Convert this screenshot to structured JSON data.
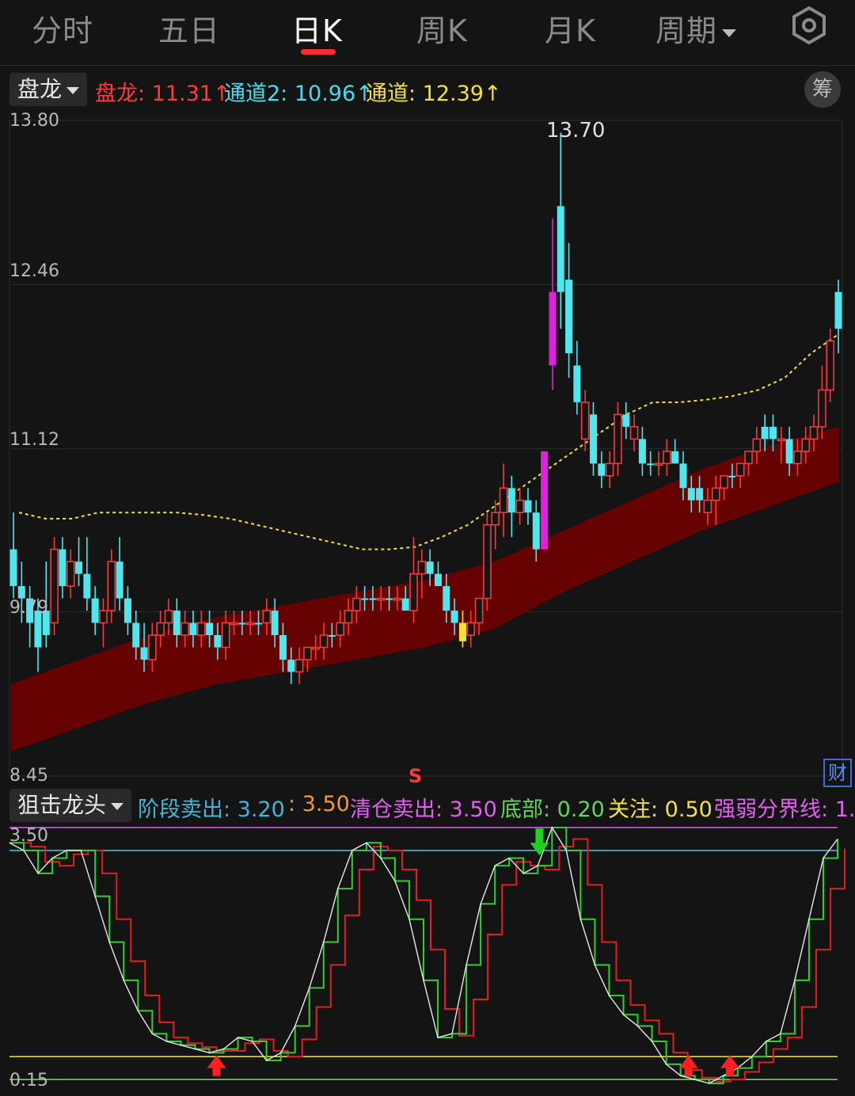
{
  "tabs": [
    {
      "label": "分时",
      "active": false
    },
    {
      "label": "五日",
      "active": false
    },
    {
      "label": "日K",
      "active": true
    },
    {
      "label": "周K",
      "active": false
    },
    {
      "label": "月K",
      "active": false
    },
    {
      "label": "周期",
      "active": false,
      "dropdown": true
    }
  ],
  "settings_icon": "settings-gear-icon",
  "main_indicator": {
    "selector_label": "盘龙",
    "values": [
      {
        "text": "盘龙: 11.31↑",
        "color": "#ff3b3b"
      },
      {
        "text": "通道2: 10.96↑",
        "color": "#3fe0f0"
      },
      {
        "text": "通道: 12.39↑",
        "color": "#f5e13a"
      }
    ],
    "chips_label": "筹"
  },
  "price_axis": {
    "labels": [
      "13.80",
      "12.46",
      "11.12",
      "9.79",
      "8.45"
    ]
  },
  "peak_label": "13.70",
  "signal_marker": "S",
  "cai_label": "财",
  "sub_indicator": {
    "selector_label": "狙击龙头",
    "values": [
      {
        "text": "阶段卖出: 3.20",
        "color": "#3fb8d8"
      },
      {
        "text": ": 3.50",
        "color": "#f09a30"
      },
      {
        "text": "清仓卖出: 3.50",
        "color": "#e060f0"
      },
      {
        "text": "底部: 0.20",
        "color": "#5ed85e"
      },
      {
        "text": "关注: 0.50",
        "color": "#f5e13a"
      },
      {
        "text": "强弱分界线: 1.",
        "color": "#e060f0"
      }
    ],
    "axis_labels": [
      "3.50",
      "0.15"
    ]
  },
  "colors": {
    "up": "#f23b3b",
    "down": "#4fe6ee",
    "band": "#6e0000",
    "ma": "#f5e13a"
  },
  "chart_data": {
    "type": "candlestick",
    "ylim": [
      8.45,
      13.8
    ],
    "peak_high": 13.7,
    "candles": [
      [
        10.3,
        10.6,
        9.9,
        10.0,
        "d"
      ],
      [
        10.0,
        10.2,
        9.7,
        9.9,
        "d"
      ],
      [
        9.9,
        10.0,
        9.5,
        9.7,
        "d"
      ],
      [
        9.5,
        9.9,
        9.3,
        9.8,
        "d"
      ],
      [
        9.8,
        10.2,
        9.5,
        9.6,
        "d"
      ],
      [
        9.7,
        10.4,
        9.6,
        10.3,
        "u"
      ],
      [
        10.3,
        10.4,
        9.9,
        10.0,
        "d"
      ],
      [
        10.0,
        10.3,
        9.9,
        10.2,
        "u"
      ],
      [
        10.2,
        10.4,
        10.0,
        10.1,
        "d"
      ],
      [
        10.1,
        10.4,
        9.8,
        9.9,
        "d"
      ],
      [
        9.9,
        10.0,
        9.6,
        9.7,
        "d"
      ],
      [
        9.7,
        9.9,
        9.5,
        9.8,
        "u"
      ],
      [
        9.8,
        10.3,
        9.7,
        10.2,
        "u"
      ],
      [
        10.2,
        10.4,
        9.8,
        9.9,
        "d"
      ],
      [
        9.9,
        10.0,
        9.6,
        9.7,
        "d"
      ],
      [
        9.7,
        9.8,
        9.4,
        9.5,
        "d"
      ],
      [
        9.5,
        9.7,
        9.3,
        9.4,
        "d"
      ],
      [
        9.4,
        9.7,
        9.3,
        9.6,
        "u"
      ],
      [
        9.6,
        9.8,
        9.5,
        9.7,
        "u"
      ],
      [
        9.7,
        9.9,
        9.6,
        9.8,
        "u"
      ],
      [
        9.8,
        9.9,
        9.5,
        9.6,
        "d"
      ],
      [
        9.6,
        9.8,
        9.5,
        9.7,
        "u"
      ],
      [
        9.7,
        9.8,
        9.5,
        9.6,
        "d"
      ],
      [
        9.6,
        9.8,
        9.5,
        9.7,
        "u"
      ],
      [
        9.7,
        9.8,
        9.5,
        9.6,
        "d"
      ],
      [
        9.6,
        9.7,
        9.4,
        9.5,
        "d"
      ],
      [
        9.5,
        9.8,
        9.4,
        9.7,
        "u"
      ],
      [
        9.7,
        9.8,
        9.6,
        9.7,
        "u"
      ],
      [
        9.7,
        9.8,
        9.6,
        9.7,
        "d"
      ],
      [
        9.7,
        9.8,
        9.6,
        9.7,
        "u"
      ],
      [
        9.7,
        9.8,
        9.6,
        9.7,
        "d"
      ],
      [
        9.7,
        9.9,
        9.6,
        9.8,
        "u"
      ],
      [
        9.8,
        9.9,
        9.5,
        9.6,
        "d"
      ],
      [
        9.6,
        9.7,
        9.3,
        9.4,
        "d"
      ],
      [
        9.4,
        9.5,
        9.2,
        9.3,
        "d"
      ],
      [
        9.3,
        9.5,
        9.2,
        9.4,
        "u"
      ],
      [
        9.4,
        9.5,
        9.3,
        9.5,
        "u"
      ],
      [
        9.5,
        9.6,
        9.4,
        9.5,
        "u"
      ],
      [
        9.5,
        9.7,
        9.4,
        9.6,
        "u"
      ],
      [
        9.6,
        9.7,
        9.5,
        9.6,
        "d"
      ],
      [
        9.6,
        9.8,
        9.5,
        9.7,
        "u"
      ],
      [
        9.7,
        9.9,
        9.6,
        9.8,
        "u"
      ],
      [
        9.8,
        10.0,
        9.7,
        9.9,
        "u"
      ],
      [
        9.9,
        10.0,
        9.8,
        9.9,
        "d"
      ],
      [
        9.9,
        10.0,
        9.8,
        9.9,
        "d"
      ],
      [
        9.9,
        10.0,
        9.8,
        9.9,
        "u"
      ],
      [
        9.9,
        10.0,
        9.8,
        9.9,
        "d"
      ],
      [
        9.9,
        10.0,
        9.8,
        9.9,
        "u"
      ],
      [
        9.9,
        10.0,
        9.8,
        9.8,
        "d"
      ],
      [
        9.8,
        10.4,
        9.7,
        10.1,
        "u"
      ],
      [
        10.1,
        10.3,
        9.9,
        10.2,
        "u"
      ],
      [
        10.2,
        10.3,
        10.0,
        10.1,
        "d"
      ],
      [
        10.1,
        10.2,
        10.0,
        10.0,
        "d"
      ],
      [
        10.0,
        10.1,
        9.7,
        9.8,
        "d"
      ],
      [
        9.8,
        9.9,
        9.6,
        9.7,
        "d"
      ],
      [
        9.7,
        9.8,
        9.5,
        9.55,
        "y"
      ],
      [
        9.6,
        9.8,
        9.5,
        9.7,
        "u"
      ],
      [
        9.7,
        9.9,
        9.6,
        9.9,
        "u"
      ],
      [
        9.9,
        10.6,
        9.8,
        10.5,
        "u"
      ],
      [
        10.5,
        10.7,
        10.3,
        10.6,
        "u"
      ],
      [
        10.6,
        11.0,
        10.4,
        10.8,
        "u"
      ],
      [
        10.8,
        10.9,
        10.4,
        10.6,
        "d"
      ],
      [
        10.6,
        10.8,
        10.5,
        10.7,
        "u"
      ],
      [
        10.7,
        10.8,
        10.5,
        10.6,
        "d"
      ],
      [
        10.6,
        10.7,
        10.2,
        10.3,
        "d"
      ],
      [
        10.3,
        11.1,
        10.3,
        11.1,
        "m"
      ],
      [
        11.8,
        13.0,
        11.6,
        12.4,
        "m"
      ],
      [
        12.4,
        13.7,
        12.1,
        13.1,
        "d"
      ],
      [
        12.5,
        12.8,
        11.7,
        11.9,
        "d"
      ],
      [
        11.8,
        12.0,
        11.4,
        11.5,
        "d"
      ],
      [
        11.5,
        11.6,
        11.1,
        11.2,
        "u"
      ],
      [
        11.4,
        11.5,
        10.9,
        11.0,
        "d"
      ],
      [
        11.0,
        11.1,
        10.8,
        10.9,
        "d"
      ],
      [
        10.9,
        11.1,
        10.8,
        11.0,
        "u"
      ],
      [
        11.0,
        11.5,
        10.9,
        11.4,
        "u"
      ],
      [
        11.4,
        11.5,
        11.2,
        11.3,
        "d"
      ],
      [
        11.3,
        11.4,
        11.1,
        11.2,
        "u"
      ],
      [
        11.2,
        11.3,
        10.9,
        11.0,
        "d"
      ],
      [
        11.0,
        11.1,
        10.9,
        11.0,
        "d"
      ],
      [
        11.0,
        11.1,
        10.9,
        11.0,
        "u"
      ],
      [
        11.0,
        11.2,
        10.9,
        11.1,
        "u"
      ],
      [
        11.1,
        11.2,
        11.0,
        11.0,
        "d"
      ],
      [
        11.0,
        11.1,
        10.7,
        10.8,
        "d"
      ],
      [
        10.8,
        10.9,
        10.6,
        10.7,
        "d"
      ],
      [
        10.7,
        10.9,
        10.6,
        10.8,
        "d"
      ],
      [
        10.6,
        10.8,
        10.5,
        10.7,
        "u"
      ],
      [
        10.7,
        10.9,
        10.5,
        10.8,
        "u"
      ],
      [
        10.8,
        10.9,
        10.7,
        10.9,
        "u"
      ],
      [
        10.9,
        11.0,
        10.8,
        10.9,
        "d"
      ],
      [
        10.9,
        11.0,
        10.8,
        11.0,
        "u"
      ],
      [
        11.0,
        11.1,
        10.9,
        11.1,
        "u"
      ],
      [
        11.1,
        11.3,
        11.0,
        11.2,
        "u"
      ],
      [
        11.2,
        11.4,
        11.1,
        11.3,
        "d"
      ],
      [
        11.3,
        11.4,
        11.1,
        11.2,
        "d"
      ],
      [
        11.2,
        11.3,
        11.0,
        11.2,
        "u"
      ],
      [
        11.2,
        11.3,
        10.9,
        11.0,
        "d"
      ],
      [
        11.0,
        11.2,
        10.9,
        11.1,
        "u"
      ],
      [
        11.1,
        11.3,
        11.0,
        11.2,
        "u"
      ],
      [
        11.2,
        11.4,
        11.1,
        11.3,
        "u"
      ],
      [
        11.3,
        11.8,
        11.2,
        11.6,
        "u"
      ],
      [
        11.6,
        12.1,
        11.5,
        12.0,
        "u"
      ],
      [
        12.1,
        12.5,
        11.9,
        12.4,
        "d"
      ]
    ],
    "ma": [
      10.6,
      10.55,
      10.55,
      10.6,
      10.6,
      10.6,
      10.6,
      10.58,
      10.55,
      10.5,
      10.45,
      10.4,
      10.35,
      10.3,
      10.3,
      10.32,
      10.4,
      10.5,
      10.65,
      10.8,
      10.95,
      11.1,
      11.25,
      11.4,
      11.5,
      11.5,
      11.52,
      11.55,
      11.6,
      11.7,
      11.9,
      12.05
    ],
    "band_upper": [
      9.2,
      9.4,
      9.6,
      9.75,
      9.85,
      9.95,
      10.05,
      10.2,
      10.45,
      10.7,
      10.95,
      11.15,
      11.3
    ],
    "band_lower": [
      8.65,
      8.85,
      9.05,
      9.2,
      9.3,
      9.4,
      9.5,
      9.65,
      9.95,
      10.2,
      10.45,
      10.65,
      10.85
    ],
    "sub": {
      "ylim": [
        0.15,
        3.5
      ],
      "lines": [
        3.5,
        3.2,
        0.5,
        0.2
      ],
      "line_colors": [
        "#e060f0",
        "#3fb8d8",
        "#f5e13a",
        "#5ed85e"
      ],
      "k": [
        3.3,
        3.2,
        2.9,
        3.1,
        3.2,
        3.2,
        2.6,
        2.0,
        1.5,
        1.1,
        0.8,
        0.7,
        0.65,
        0.6,
        0.55,
        0.6,
        0.75,
        0.7,
        0.45,
        0.55,
        0.9,
        1.4,
        2.0,
        2.7,
        3.2,
        3.3,
        3.1,
        2.8,
        2.3,
        1.5,
        0.75,
        0.8,
        1.7,
        2.5,
        3.0,
        3.1,
        2.9,
        3.0,
        3.5,
        3.2,
        2.3,
        1.7,
        1.3,
        1.05,
        0.9,
        0.7,
        0.4,
        0.25,
        0.2,
        0.15,
        0.25,
        0.35,
        0.5,
        0.7,
        0.8,
        1.5,
        2.3,
        3.1,
        3.35
      ],
      "arrows_up": [
        0.25,
        0.82,
        0.87
      ],
      "arrows_down": [
        0.64
      ]
    }
  }
}
